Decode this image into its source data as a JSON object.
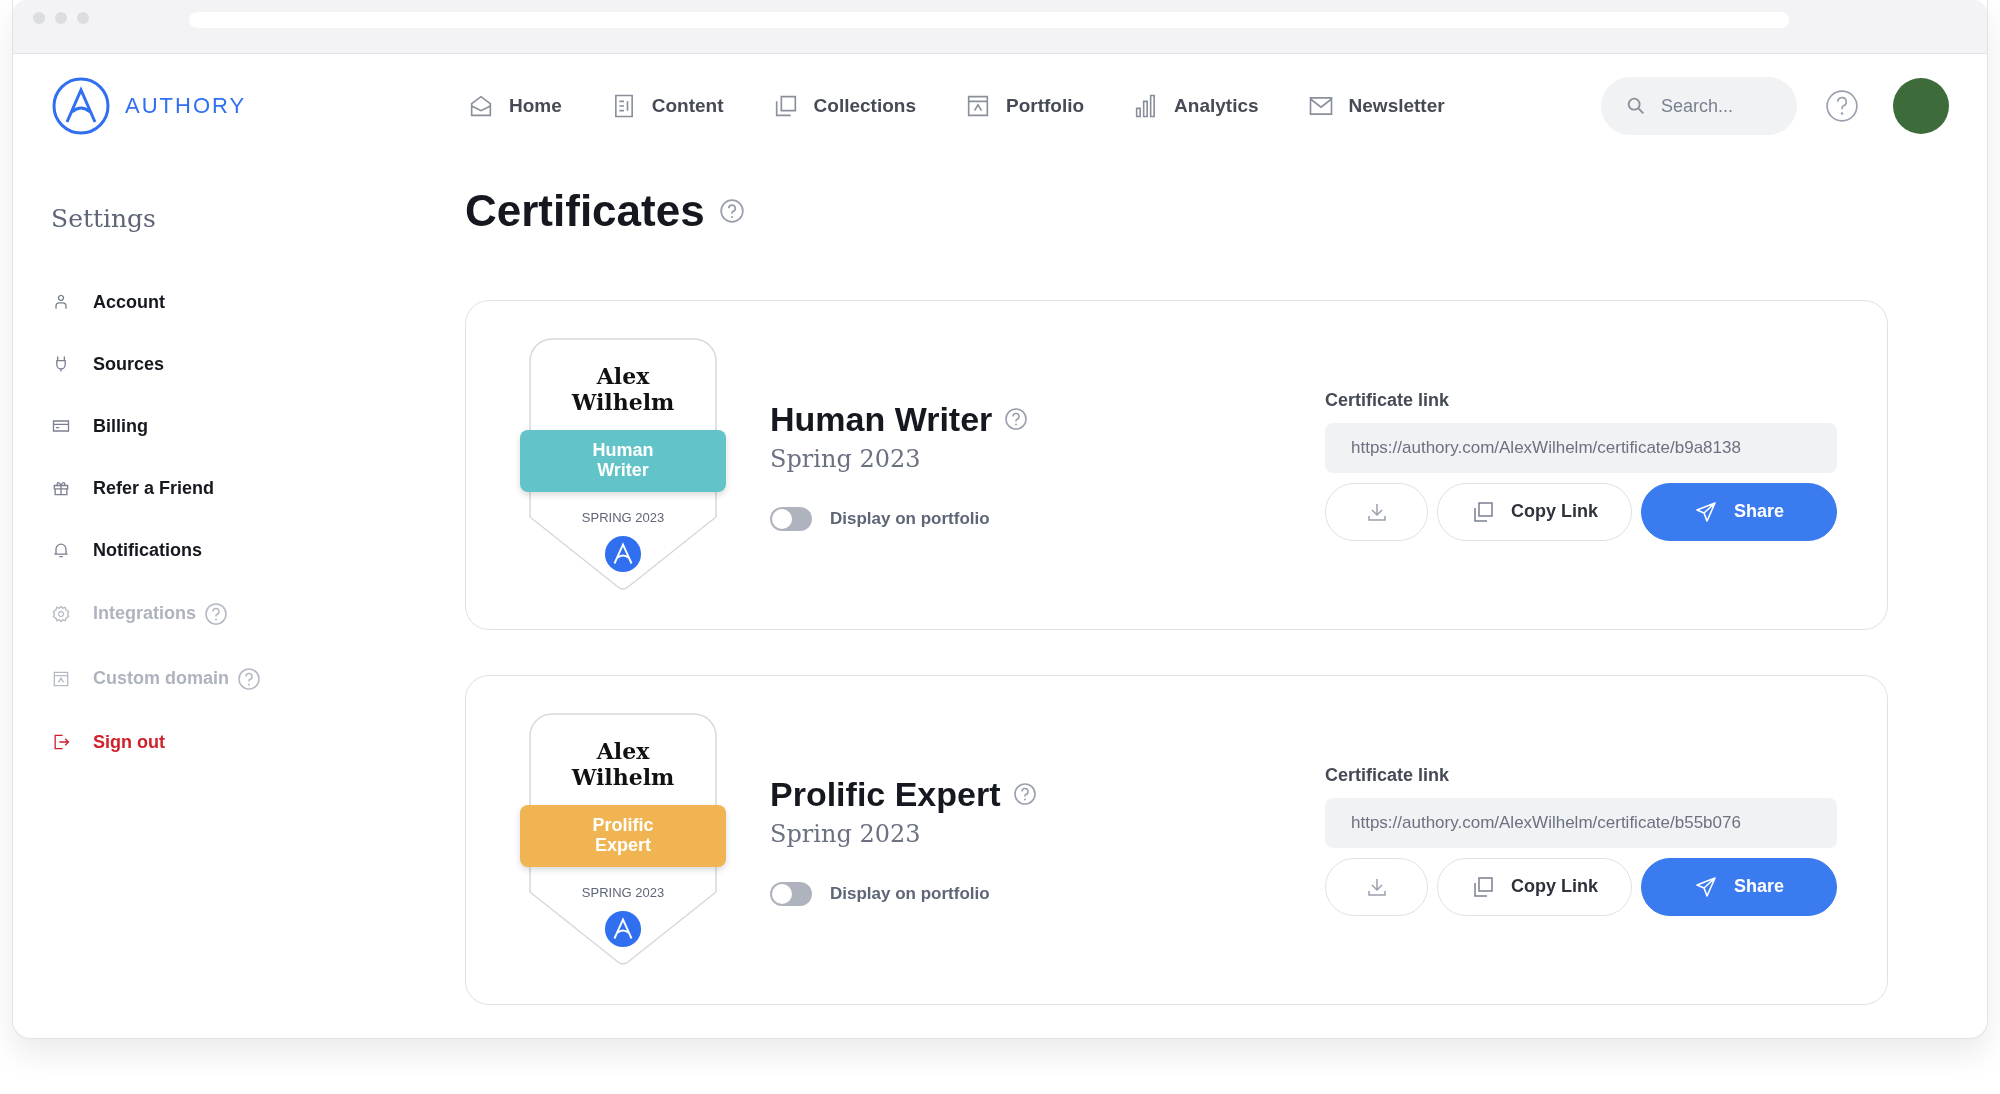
{
  "brand": {
    "name": "AUTHORY"
  },
  "nav": [
    {
      "label": "Home"
    },
    {
      "label": "Content"
    },
    {
      "label": "Collections"
    },
    {
      "label": "Portfolio"
    },
    {
      "label": "Analytics"
    },
    {
      "label": "Newsletter"
    }
  ],
  "search": {
    "placeholder": "Search..."
  },
  "sidebar": {
    "title": "Settings",
    "items": [
      {
        "label": "Account",
        "disabled": false,
        "help": false,
        "kind": "link"
      },
      {
        "label": "Sources",
        "disabled": false,
        "help": false,
        "kind": "link"
      },
      {
        "label": "Billing",
        "disabled": false,
        "help": false,
        "kind": "link"
      },
      {
        "label": "Refer a Friend",
        "disabled": false,
        "help": false,
        "kind": "link"
      },
      {
        "label": "Notifications",
        "disabled": false,
        "help": false,
        "kind": "link"
      },
      {
        "label": "Integrations",
        "disabled": true,
        "help": true,
        "kind": "link"
      },
      {
        "label": "Custom domain",
        "disabled": true,
        "help": true,
        "kind": "link"
      },
      {
        "label": "Sign out",
        "disabled": false,
        "help": false,
        "kind": "danger"
      }
    ]
  },
  "page": {
    "title": "Certificates"
  },
  "certificates": [
    {
      "badge": {
        "name": "Alex Wilhelm",
        "ribbon": "Human Writer",
        "color": "#62c4c9",
        "season": "SPRING 2023"
      },
      "title": "Human Writer",
      "subtitle": "Spring 2023",
      "toggle": {
        "label": "Display on portfolio",
        "on": false
      },
      "link_label": "Certificate link",
      "url": "https://authory.com/AlexWilhelm/certificate/b9a8138",
      "copy_label": "Copy Link",
      "share_label": "Share"
    },
    {
      "badge": {
        "name": "Alex Wilhelm",
        "ribbon": "Prolific Expert",
        "color": "#f0b452",
        "season": "SPRING 2023"
      },
      "title": "Prolific Expert",
      "subtitle": "Spring 2023",
      "toggle": {
        "label": "Display on portfolio",
        "on": false
      },
      "link_label": "Certificate link",
      "url": "https://authory.com/AlexWilhelm/certificate/b55b076",
      "copy_label": "Copy Link",
      "share_label": "Share"
    }
  ]
}
